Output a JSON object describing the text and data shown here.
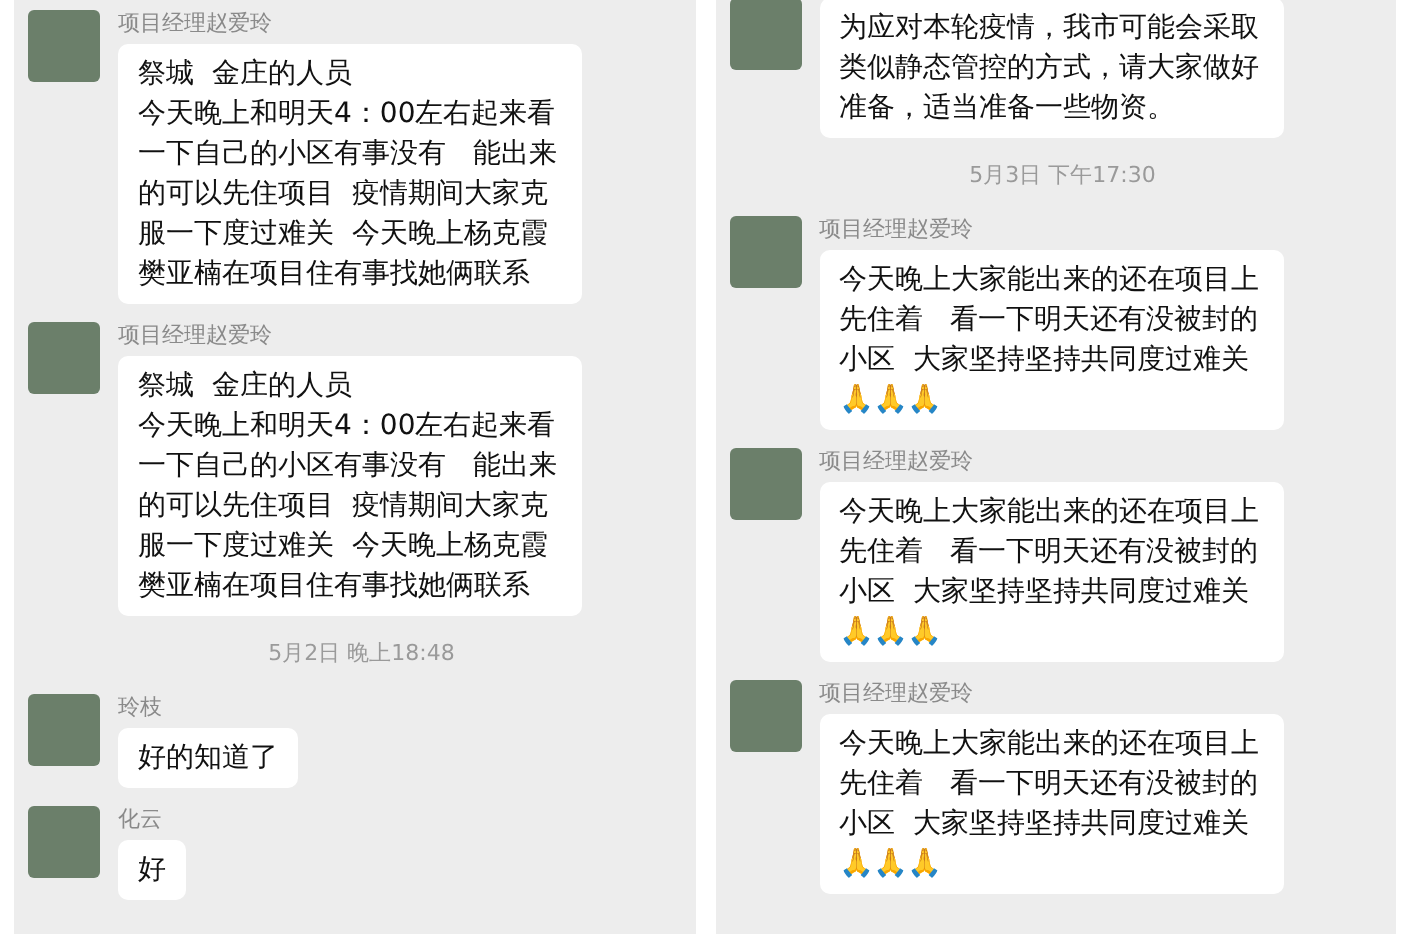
{
  "panels": [
    {
      "items": [
        {
          "kind": "message",
          "sender": "项目经理赵爱玲",
          "paragraphs": [
            "祭城  金庄的人员",
            "今天晚上和明天4：00左右起来看一下自己的小区有事没有   能出来的可以先住项目  疫情期间大家克服一下度过难关  今天晚上杨克霞樊亚楠在项目住有事找她俩联系"
          ]
        },
        {
          "kind": "message",
          "sender": "项目经理赵爱玲",
          "paragraphs": [
            "祭城  金庄的人员",
            "今天晚上和明天4：00左右起来看一下自己的小区有事没有   能出来的可以先住项目  疫情期间大家克服一下度过难关  今天晚上杨克霞樊亚楠在项目住有事找她俩联系"
          ]
        },
        {
          "kind": "time",
          "text": "5月2日 晚上18:48"
        },
        {
          "kind": "message",
          "sender": "玲枝",
          "paragraphs": [
            "好的知道了"
          ]
        },
        {
          "kind": "message",
          "sender": "化云",
          "paragraphs": [
            "好"
          ]
        }
      ]
    },
    {
      "items": [
        {
          "kind": "message",
          "paragraphs": [
            "为应对本轮疫情，我市可能会采取类似静态管控的方式，请大家做好准备，适当准备一些物资。"
          ]
        },
        {
          "kind": "time",
          "text": "5月3日 下午17:30"
        },
        {
          "kind": "message",
          "sender": "项目经理赵爱玲",
          "paragraphs": [
            "今天晚上大家能出来的还在项目上先住着   看一下明天还有没被封的小区  大家坚持坚持共同度过难关🙏🙏🙏"
          ]
        },
        {
          "kind": "message",
          "sender": "项目经理赵爱玲",
          "paragraphs": [
            "今天晚上大家能出来的还在项目上先住着   看一下明天还有没被封的小区  大家坚持坚持共同度过难关🙏🙏🙏"
          ]
        },
        {
          "kind": "message",
          "sender": "项目经理赵爱玲",
          "paragraphs": [
            "今天晚上大家能出来的还在项目上先住着   看一下明天还有没被封的小区  大家坚持坚持共同度过难关🙏🙏🙏"
          ]
        }
      ]
    }
  ]
}
